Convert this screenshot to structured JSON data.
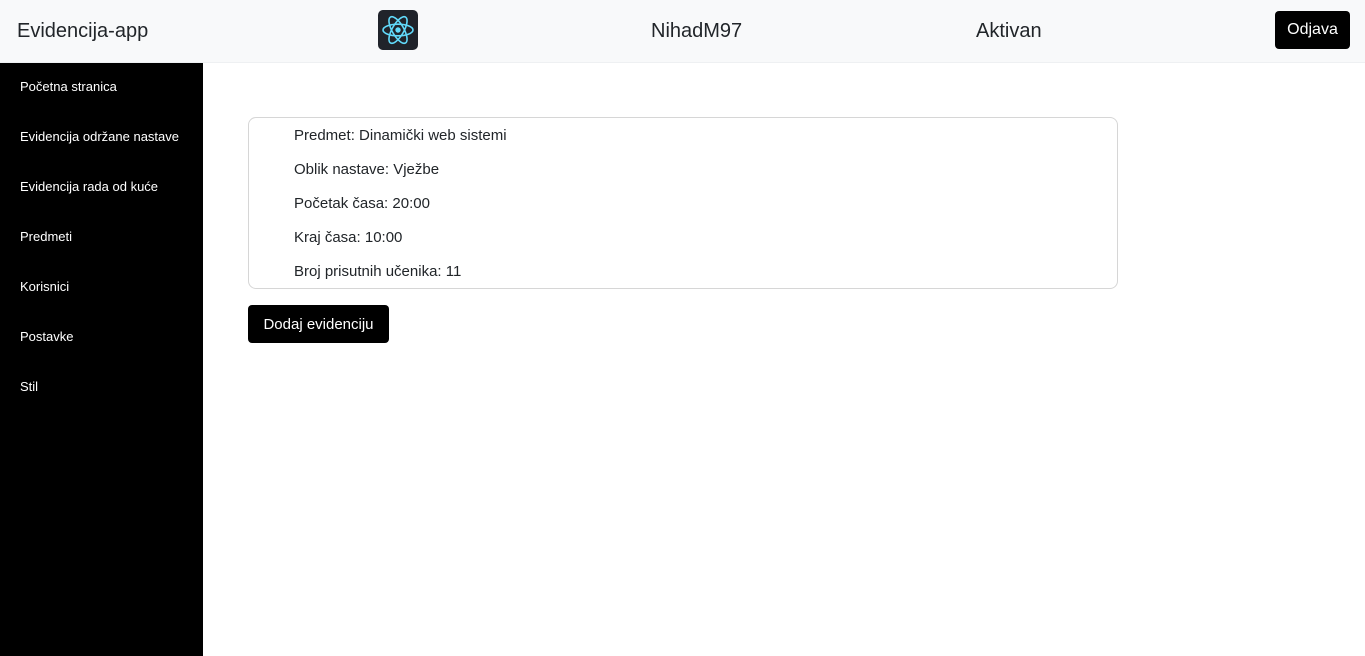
{
  "navbar": {
    "brand": "Evidencija-app",
    "logo_icon": "react-logo-icon",
    "username": "NihadM97",
    "status": "Aktivan",
    "logout_label": "Odjava"
  },
  "sidebar": {
    "items": [
      {
        "label": "Početna stranica"
      },
      {
        "label": "Evidencija održane nastave"
      },
      {
        "label": "Evidencija rada od kuće"
      },
      {
        "label": "Predmeti"
      },
      {
        "label": "Korisnici"
      },
      {
        "label": "Postavke"
      },
      {
        "label": "Stil"
      }
    ]
  },
  "record": {
    "subject": "Predmet: Dinamički web sistemi",
    "form": "Oblik nastave: Vježbe",
    "start": "Početak časa: 20:00",
    "end": "Kraj časa: 10:00",
    "attendance": "Broj prisutnih učenika: 11"
  },
  "actions": {
    "add_label": "Dodaj evidenciju"
  },
  "colors": {
    "navbar_bg": "#f8f9fa",
    "sidebar_bg": "#000000",
    "button_bg": "#000000",
    "logo_bg": "#20232a",
    "logo_accent": "#61dafb"
  }
}
